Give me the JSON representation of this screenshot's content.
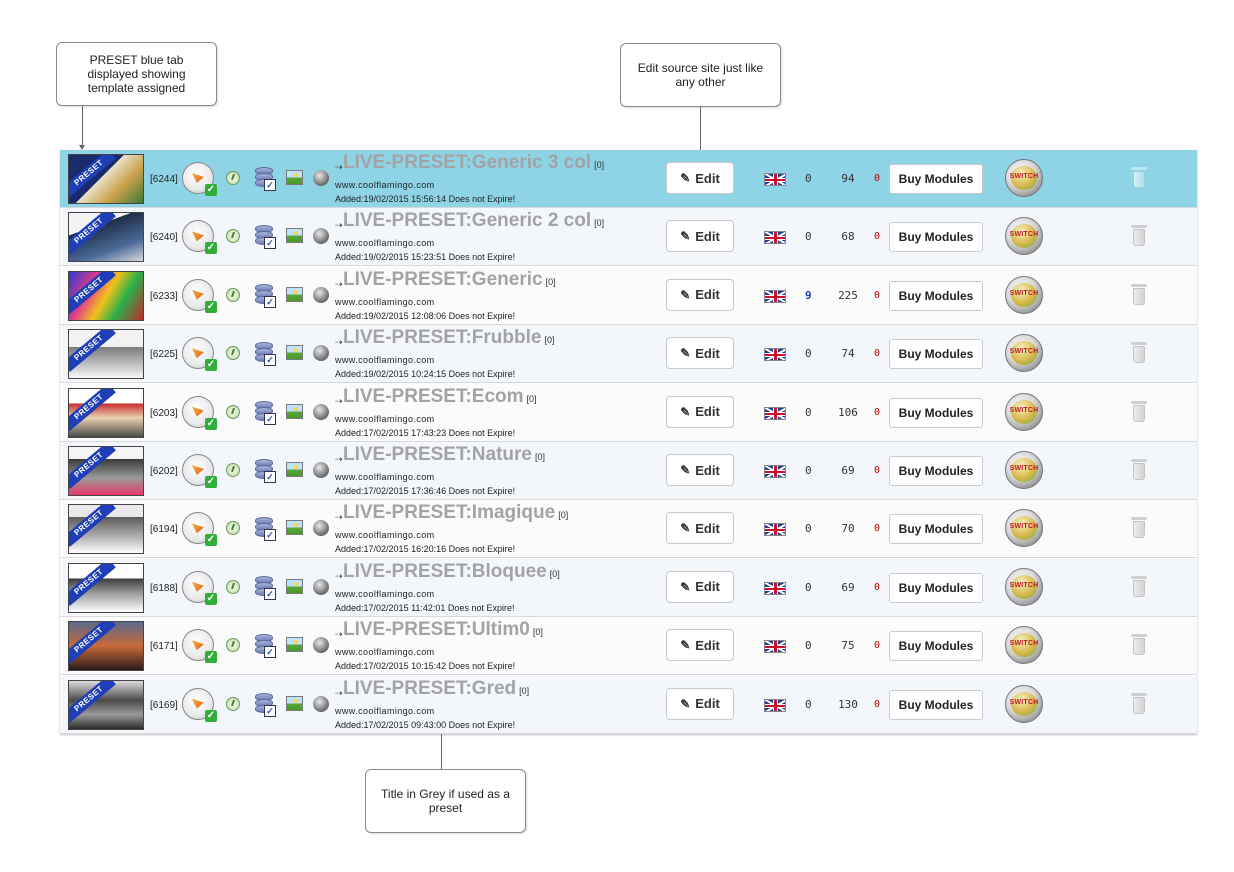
{
  "callouts": {
    "preset_tab": "PRESET blue tab displayed showing template assigned",
    "edit_source": "Edit source site just like any other",
    "title_grey": "Title in Grey if used as a preset"
  },
  "labels": {
    "edit": "Edit",
    "buy_modules": "Buy Modules",
    "switch": "SWITCH",
    "preset_ribbon": "PRESET",
    "title_arrow": "⇢"
  },
  "colors": {
    "selected_row": "#8fd3e6",
    "title_grey": "#a3a3a3",
    "ribbon": "#1f3fb8"
  },
  "rows": [
    {
      "id": "[6244]",
      "title": "LIVE-PRESET:Generic 3 col",
      "count": "[0]",
      "url": "www.coolflamingo.com",
      "added": "Added:19/02/2015 15:56:14  Does not Expire!",
      "n1": "0",
      "n2": "94",
      "n3": "0",
      "selected": true
    },
    {
      "id": "[6240]",
      "title": "LIVE-PRESET:Generic 2 col",
      "count": "[0]",
      "url": "www.coolflamingo.com",
      "added": "Added:19/02/2015 15:23:51  Does not Expire!",
      "n1": "0",
      "n2": "68",
      "n3": "0"
    },
    {
      "id": "[6233]",
      "title": "LIVE-PRESET:Generic",
      "count": "[0]",
      "url": "www.coolflamingo.com",
      "added": "Added:19/02/2015 12:08:06  Does not Expire!",
      "n1": "9",
      "n2": "225",
      "n3": "0",
      "n1_highlight": true
    },
    {
      "id": "[6225]",
      "title": "LIVE-PRESET:Frubble",
      "count": "[0]",
      "url": "www.coolflamingo.com",
      "added": "Added:19/02/2015 10:24:15  Does not Expire!",
      "n1": "0",
      "n2": "74",
      "n3": "0"
    },
    {
      "id": "[6203]",
      "title": "LIVE-PRESET:Ecom",
      "count": "[0]",
      "url": "www.coolflamingo.com",
      "added": "Added:17/02/2015 17:43:23  Does not Expire!",
      "n1": "0",
      "n2": "106",
      "n3": "0"
    },
    {
      "id": "[6202]",
      "title": "LIVE-PRESET:Nature",
      "count": "[0]",
      "url": "www.coolflamingo.com",
      "added": "Added:17/02/2015 17:36:46  Does not Expire!",
      "n1": "0",
      "n2": "69",
      "n3": "0"
    },
    {
      "id": "[6194]",
      "title": "LIVE-PRESET:Imagique",
      "count": "[0]",
      "url": "www.coolflamingo.com",
      "added": "Added:17/02/2015 16:20:16  Does not Expire!",
      "n1": "0",
      "n2": "70",
      "n3": "0"
    },
    {
      "id": "[6188]",
      "title": "LIVE-PRESET:Bloquee",
      "count": "[0]",
      "url": "www.coolflamingo.com",
      "added": "Added:17/02/2015 11:42:01  Does not Expire!",
      "n1": "0",
      "n2": "69",
      "n3": "0"
    },
    {
      "id": "[6171]",
      "title": "LIVE-PRESET:Ultim0",
      "count": "[0]",
      "url": "www.coolflamingo.com",
      "added": "Added:17/02/2015 10:15:42  Does not Expire!",
      "n1": "0",
      "n2": "75",
      "n3": "0"
    },
    {
      "id": "[6169]",
      "title": "LIVE-PRESET:Gred",
      "count": "[0]",
      "url": "www.coolflamingo.com",
      "added": "Added:17/02/2015 09:43:00  Does not Expire!",
      "n1": "0",
      "n2": "130",
      "n3": "0"
    }
  ]
}
